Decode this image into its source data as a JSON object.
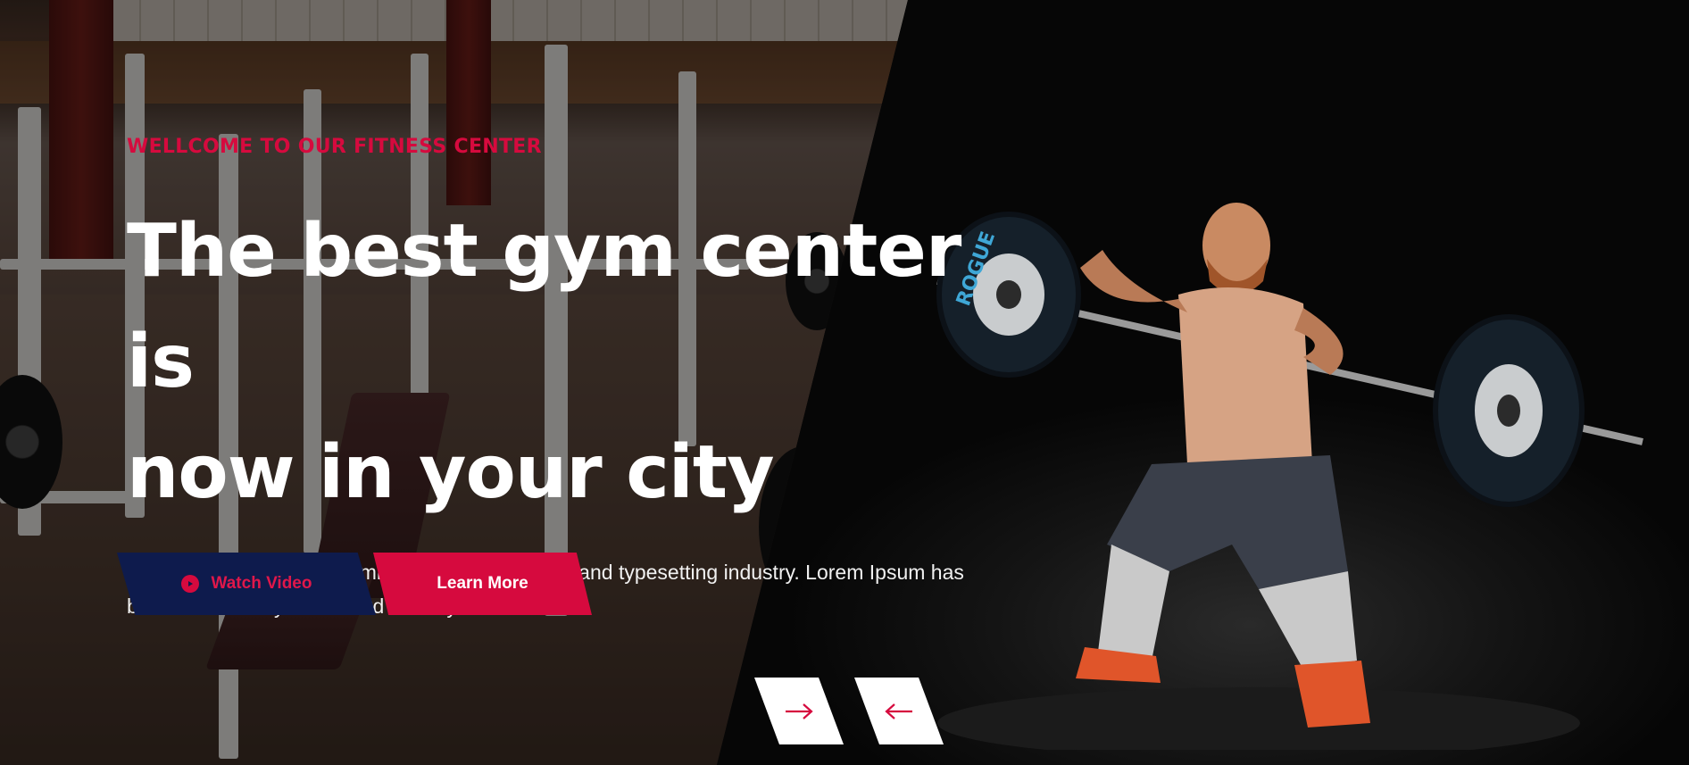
{
  "hero": {
    "eyebrow": "WELLCOME TO OUR FITNESS CENTER",
    "headline_line1": "The best gym center is",
    "headline_line2": "now in your city",
    "lead": "Lorem Ipsum is simply dummy text of the printing and typesetting industry. Lorem Ipsum has been the industry's standard dummy..."
  },
  "buttons": {
    "watch_video_label": "Watch Video",
    "watch_video_icon": "play-circle-icon",
    "learn_more_label": "Learn More"
  },
  "slider": {
    "next_icon": "arrow-right-icon",
    "prev_icon": "arrow-left-icon"
  },
  "colors": {
    "accent": "#d60a3e",
    "navy": "#0e1b4d",
    "text": "#ffffff"
  }
}
